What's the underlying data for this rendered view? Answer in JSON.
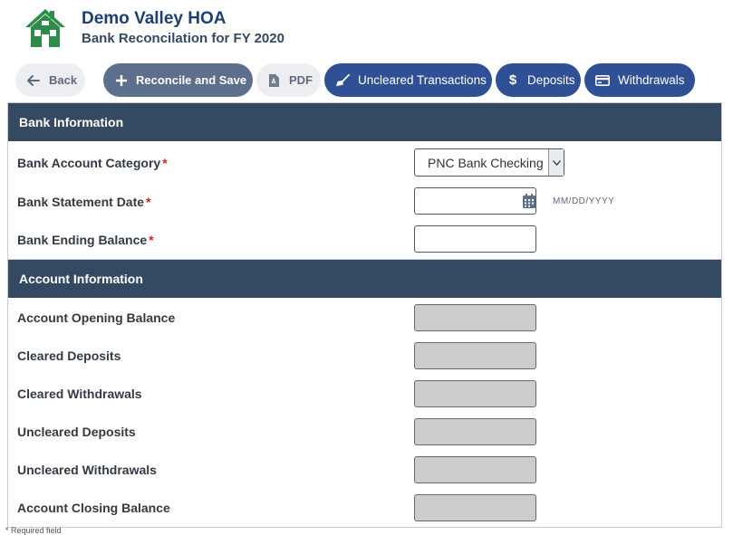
{
  "header": {
    "org_name": "Demo Valley HOA",
    "subtitle": "Bank Reconcilation for FY 2020",
    "logo_icon": "house-logo-icon",
    "logo_color": "#2e8b4a"
  },
  "toolbar": {
    "back_label": "Back",
    "save_label": "Reconcile and Save",
    "pdf_label": "PDF",
    "uncleared_label": "Uncleared Transactions",
    "deposits_label": "Deposits",
    "withdrawals_label": "Withdrawals"
  },
  "bank_section": {
    "title": "Bank Information",
    "account_category": {
      "label": "Bank Account Category",
      "required_mark": "*",
      "selected": "PNC Bank Checking"
    },
    "statement_date": {
      "label": "Bank Statement Date",
      "required_mark": "*",
      "value": "",
      "format_hint": "MM/DD/YYYY"
    },
    "ending_balance": {
      "label": "Bank Ending Balance",
      "required_mark": "*",
      "value": ""
    }
  },
  "account_section": {
    "title": "Account Information",
    "rows": [
      {
        "label": "Account Opening Balance",
        "value": ""
      },
      {
        "label": "Cleared Deposits",
        "value": ""
      },
      {
        "label": "Cleared Withdrawals",
        "value": ""
      },
      {
        "label": "Uncleared Deposits",
        "value": ""
      },
      {
        "label": "Uncleared Withdrawals",
        "value": ""
      },
      {
        "label": "Account Closing Balance",
        "value": ""
      }
    ]
  },
  "footnote": "* Required field"
}
